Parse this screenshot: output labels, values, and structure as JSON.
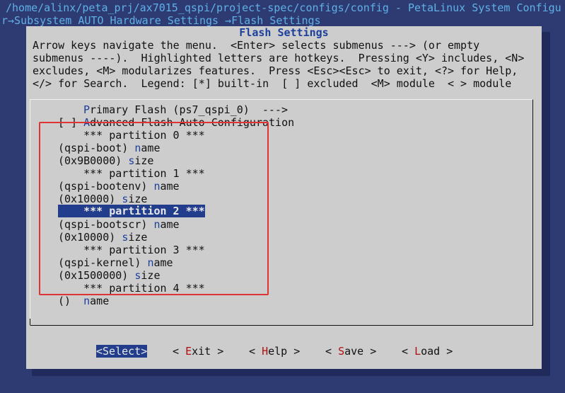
{
  "terminal": {
    "path": "/home/alinx/peta_prj/ax7015_qspi/project-spec/configs/config - PetaLinux System Configu",
    "breadcrumb": "r→Subsystem AUTO Hardware Settings →Flash Settings"
  },
  "dialog": {
    "title": "Flash Settings",
    "help": [
      "Arrow keys navigate the menu.  <Enter> selects submenus ---> (or empty",
      "submenus ----).  Highlighted letters are hotkeys.  Pressing <Y> includes, <N>",
      "excludes, <M> modularizes features.  Press <Esc><Esc> to exit, <?> for Help,",
      "</> for Search.  Legend: [*] built-in  [ ] excluded  <M> module  < > module"
    ]
  },
  "menu": {
    "primary_hk": "P",
    "primary_rest": "rimary Flash (ps7_qspi_0)  --->",
    "adv_check": "[ ] ",
    "adv_hk": "A",
    "adv_rest": "dvanced Flash Auto Configuration",
    "p0_header": "    *** partition 0 ***",
    "p0_name_val": "(qspi-boot) ",
    "p0_name_hk": "n",
    "p0_name_rest": "ame",
    "p0_size_val": "(0x9B0000) ",
    "p0_size_hk": "s",
    "p0_size_rest": "ize",
    "p1_header": "    *** partition 1 ***",
    "p1_name_val": "(qspi-bootenv) ",
    "p1_name_hk": "n",
    "p1_name_rest": "ame",
    "p1_size_val": "(0x10000) ",
    "p1_size_hk": "s",
    "p1_size_rest": "ize",
    "p2_header": "    *** partition 2 ***",
    "p2_name_val": "(qspi-bootscr) ",
    "p2_name_hk": "n",
    "p2_name_rest": "ame",
    "p2_size_val": "(0x10000) ",
    "p2_size_hk": "s",
    "p2_size_rest": "ize",
    "p3_header": "    *** partition 3 ***",
    "p3_name_val": "(qspi-kernel) ",
    "p3_name_hk": "n",
    "p3_name_rest": "ame",
    "p3_size_val": "(0x1500000) ",
    "p3_size_hk": "s",
    "p3_size_rest": "ize",
    "p4_header": "    *** partition 4 ***",
    "p4_name_val": "()  ",
    "p4_name_hk": "n",
    "p4_name_rest": "ame"
  },
  "buttons": {
    "select": "<Select>",
    "exit_l": "< ",
    "exit_hk": "E",
    "exit_r": "xit >",
    "help_l": "< ",
    "help_hk": "H",
    "help_r": "elp >",
    "save_l": "< ",
    "save_hk": "S",
    "save_r": "ave >",
    "load_l": "< ",
    "load_hk": "L",
    "load_r": "oad >"
  },
  "colors": {
    "background": "#2e3b73",
    "dialog": "#cdcdcd",
    "highlight": "#223d8c",
    "hotkey_menu": "#1b3f9b",
    "hotkey_button": "#b01010",
    "annotation": "#e03434"
  }
}
